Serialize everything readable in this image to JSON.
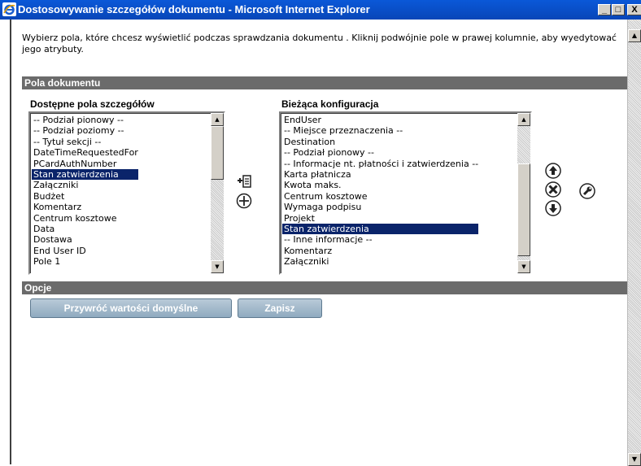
{
  "window": {
    "title": "Dostosowywanie szczegółów dokumentu - Microsoft Internet Explorer",
    "min_label": "_",
    "max_label": "□",
    "close_label": "X"
  },
  "intro_text": "Wybierz pola, które chcesz wyświetlić podczas sprawdzania dokumentu . Kliknij podwójnie pole w prawej kolumnie, aby wyedytować jego atrybuty.",
  "section_fields": {
    "title": "Pola dokumentu",
    "available": {
      "label": "Dostępne pola szczegółów",
      "items": [
        "-- Podział pionowy --",
        "-- Podział poziomy --",
        "-- Tytuł sekcji --",
        "DateTimeRequestedFor",
        "PCardAuthNumber",
        "Stan zatwierdzenia",
        "Załączniki",
        "Budżet",
        "Komentarz",
        "Centrum kosztowe",
        "Data",
        "Dostawa",
        "End User ID",
        "Pole 1"
      ],
      "selected_index": 5
    },
    "current": {
      "label": "Bieżąca konfiguracja",
      "items": [
        "EndUser",
        "-- Miejsce przeznaczenia --",
        "Destination",
        "-- Podział pionowy --",
        "-- Informacje nt. płatności i zatwierdzenia --",
        "Karta płatnicza",
        "Kwota maks.",
        "Centrum kosztowe",
        "Wymaga podpisu",
        "Projekt",
        "Stan zatwierdzenia",
        "-- Inne informacje --",
        "Komentarz",
        "Załączniki"
      ],
      "selected_index": 10
    },
    "icons": [
      "insert-icon",
      "add-icon",
      "move-up-icon",
      "remove-icon",
      "move-down-icon",
      "wrench-icon"
    ]
  },
  "section_options": {
    "title": "Opcje",
    "restore_label": "Przywróć wartości domyślne",
    "save_label": "Zapisz"
  },
  "colors": {
    "title_bar": "#0a58d8",
    "section_bar": "#6b6b6b",
    "selection": "#0a246a",
    "button": "#a3b8c9"
  }
}
